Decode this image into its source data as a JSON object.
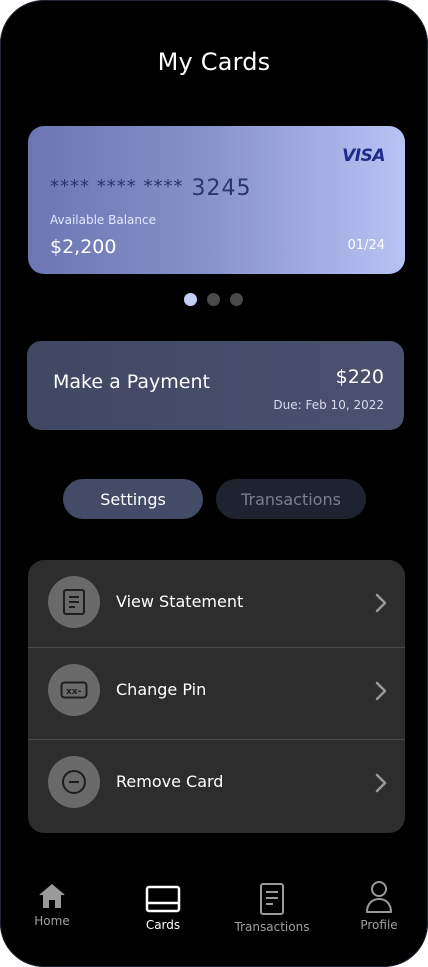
{
  "header": {
    "title": "My Cards"
  },
  "card": {
    "brand": "VISA",
    "masked_prefix": "**** **** ****",
    "last4": "3245",
    "balance_label": "Available Balance",
    "balance": "$2,200",
    "expiry": "01/24",
    "pager": {
      "count": 3,
      "active_index": 0
    }
  },
  "payment": {
    "label": "Make a Payment",
    "amount": "$220",
    "due": "Due: Feb 10, 2022"
  },
  "tabs": [
    {
      "label": "Settings",
      "active": true
    },
    {
      "label": "Transactions",
      "active": false
    }
  ],
  "settings": {
    "items": [
      {
        "label": "View Statement",
        "icon": "document-icon"
      },
      {
        "label": "Change Pin",
        "icon": "pin-icon"
      },
      {
        "label": "Remove Card",
        "icon": "minus-circle-icon"
      }
    ]
  },
  "nav": {
    "items": [
      {
        "label": "Home",
        "icon": "home-icon",
        "active": false
      },
      {
        "label": "Cards",
        "icon": "card-icon",
        "active": true
      },
      {
        "label": "Transactions",
        "icon": "document-icon",
        "active": false
      },
      {
        "label": "Profile",
        "icon": "user-icon",
        "active": false
      }
    ]
  },
  "colors": {
    "background": "#000000",
    "card_gradient_start": "#6b76b3",
    "card_gradient_end": "#b8c2f5",
    "panel": "#2d2d2d",
    "accent": "#434b66"
  }
}
